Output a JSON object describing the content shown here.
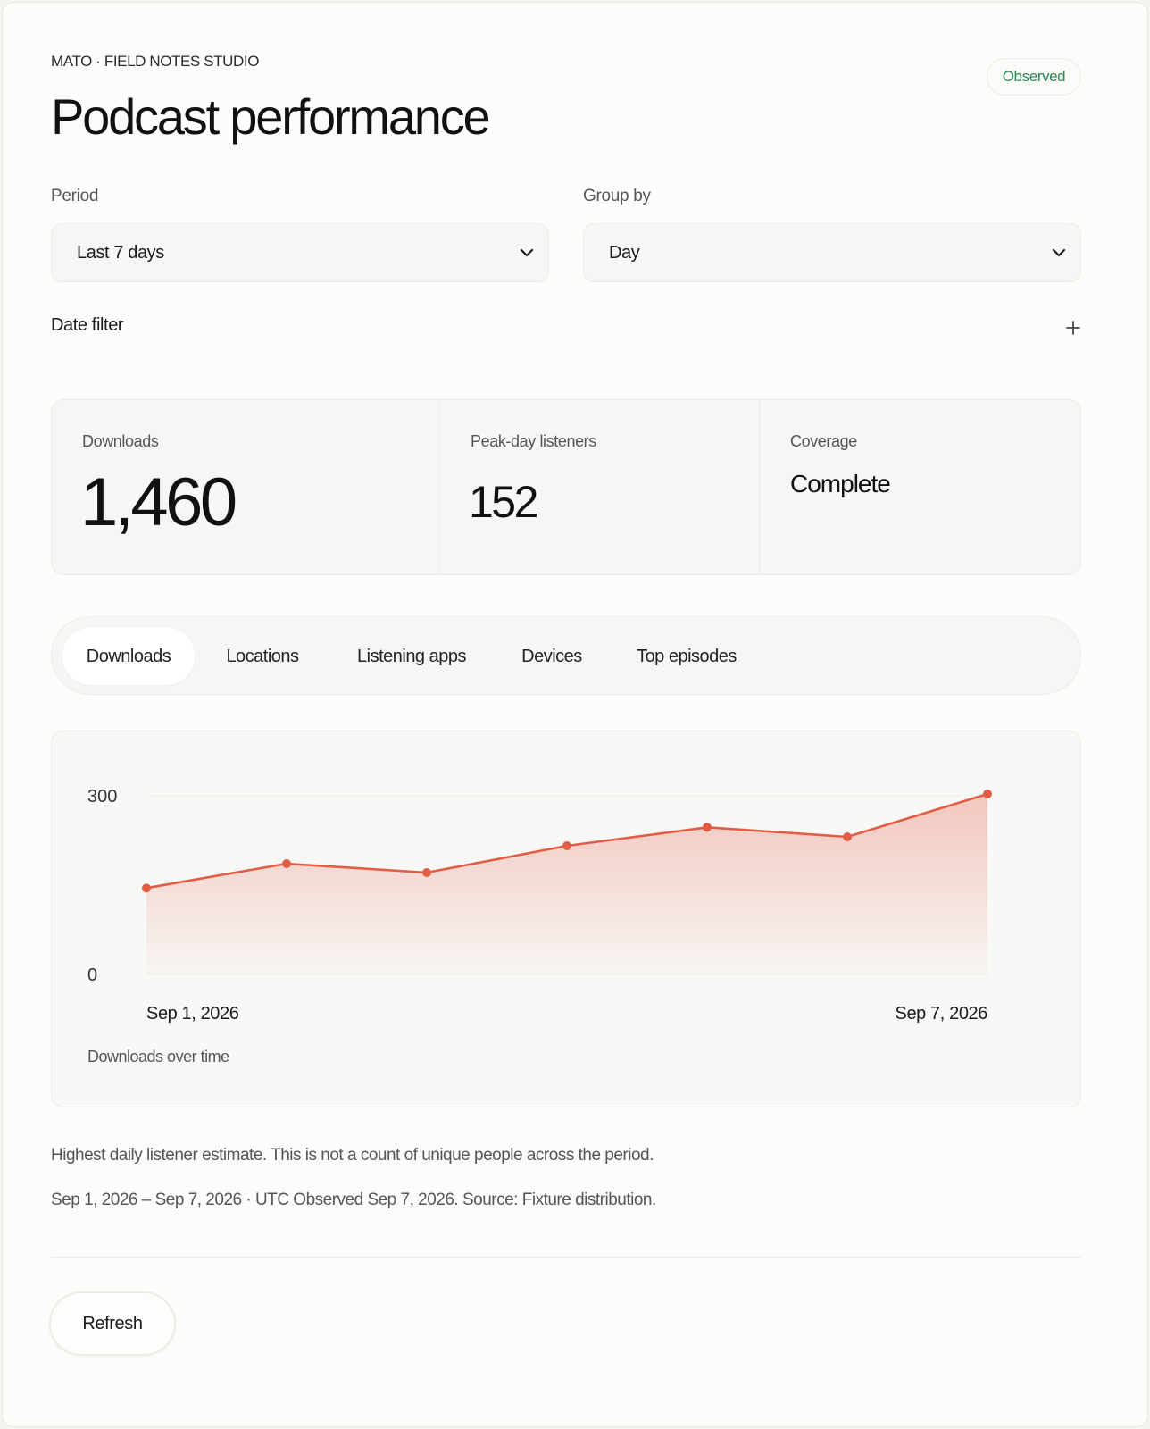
{
  "header": {
    "eyebrow": "MATO · FIELD NOTES STUDIO",
    "title": "Podcast performance",
    "status_badge": "Observed",
    "status_color": "#2f8a5a"
  },
  "filters": {
    "period_label": "Period",
    "period_value": "Last 7 days",
    "group_by_label": "Group by",
    "group_by_value": "Day",
    "date_filter_label": "Date filter",
    "date_filter_icon": "plus-icon"
  },
  "stats": {
    "downloads_label": "Downloads",
    "downloads_value": "1,460",
    "peak_label": "Peak-day listeners",
    "peak_value": "152",
    "coverage_label": "Coverage",
    "coverage_value": "Complete"
  },
  "tabs": [
    {
      "label": "Downloads",
      "active": true
    },
    {
      "label": "Locations",
      "active": false
    },
    {
      "label": "Listening apps",
      "active": false
    },
    {
      "label": "Devices",
      "active": false
    },
    {
      "label": "Top episodes",
      "active": false
    }
  ],
  "chart_data": {
    "type": "area",
    "x": [
      "2026-09-01",
      "2026-09-02",
      "2026-09-03",
      "2026-09-04",
      "2026-09-05",
      "2026-09-06",
      "2026-09-07"
    ],
    "series": [
      {
        "values": [
          145,
          186,
          171,
          216,
          247,
          231,
          303
        ]
      }
    ],
    "ylim": [
      0,
      300
    ],
    "yticks": [
      "300",
      "0"
    ],
    "xtick_labels": [
      "Sep 1, 2026",
      "Sep 7, 2026"
    ],
    "caption": "Downloads over time",
    "line_color": "#e35d45",
    "grid": true
  },
  "notes": {
    "peak_note": "Highest daily listener estimate. This is not a count of unique people across the period.",
    "range_note": "Sep 1, 2026 – Sep 7, 2026 · UTC Observed Sep 7, 2026. Source: Fixture distribution."
  },
  "actions": {
    "refresh_label": "Refresh"
  }
}
